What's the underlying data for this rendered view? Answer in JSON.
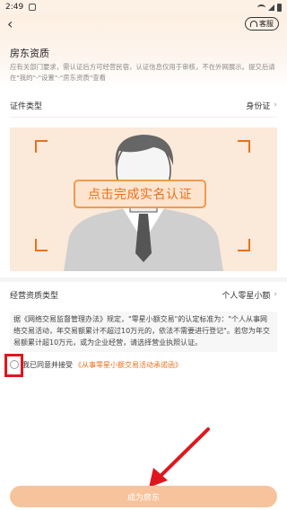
{
  "status_bar": {
    "time": "2:49"
  },
  "header": {
    "customer_service_label": "客服"
  },
  "page": {
    "title": "房东资质",
    "description": "应有关部门要求，需认证后方可经营民宿，认证信息仅用于审核，不在外网展示。提交后请在\"我的\"-\"设置\"-\"房东资质\"查看"
  },
  "id_type": {
    "label": "证件类型",
    "value": "身份证"
  },
  "auth_card": {
    "button_label": "点击完成实名认证"
  },
  "business": {
    "label": "经营资质类型",
    "value": "个人零星小额"
  },
  "notice": {
    "text": "据《网络交易监督管理办法》规定，\"零星小额交易\"的认定标准为：\"个人从事网络交易活动，年交易额累计不超过10万元的，依法不需要进行登记\"。若您为年交易额累计超10万元，或为企业经营，请选择营业执照认证。"
  },
  "agreement": {
    "prefix": "我已同意并接受",
    "link": "《从事零星小额交易活动承诺函》",
    "checked": false
  },
  "submit": {
    "label": "成为房东"
  },
  "colors": {
    "accent": "#e8711c",
    "annotation_red": "#e0161e",
    "button_disabled": "#f7c39c"
  }
}
